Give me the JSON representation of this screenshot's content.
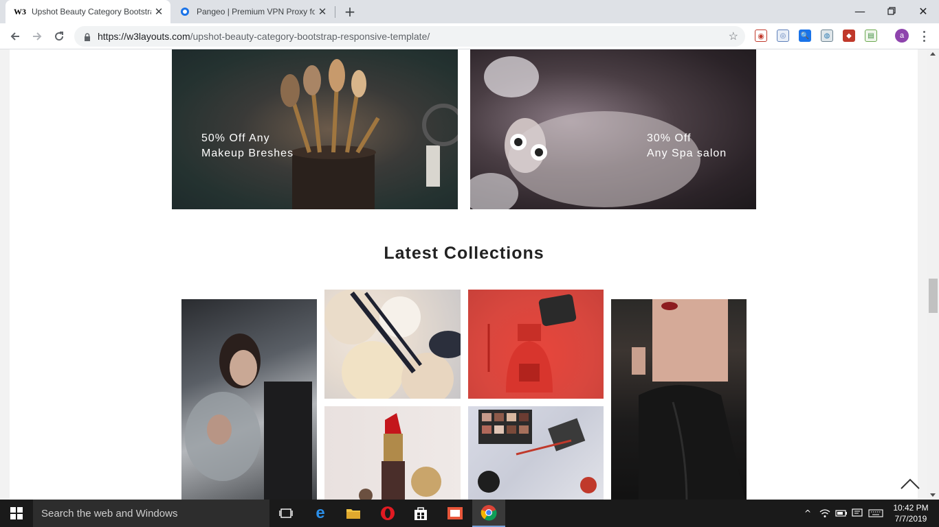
{
  "browser": {
    "tabs": [
      {
        "title": "Upshot Beauty Category Bootstra",
        "favicon": "w3layouts-icon"
      },
      {
        "title": "Pangeo | Premium VPN Proxy for",
        "favicon": "pangeo-icon"
      }
    ],
    "favicon_text": "W3",
    "url_host": "https://w3layouts.com",
    "url_path": "/upshot-beauty-category-bootstrap-responsive-template/",
    "profile_initial": "a"
  },
  "page": {
    "promo_left": {
      "line1": "50% Off Any",
      "line2": "Makeup Breshes"
    },
    "promo_right": {
      "line1": "30% Off",
      "line2": "Any Spa salon"
    },
    "section_title": "Latest Collections"
  },
  "taskbar": {
    "search_placeholder": "Search the web and Windows",
    "time": "10:42 PM",
    "date": "7/7/2019"
  },
  "colors": {
    "accent_blue": "#1a73e8",
    "taskbar_bg": "#1a1a1a",
    "tab_strip": "#dee1e6",
    "profile": "#8e44ad"
  }
}
